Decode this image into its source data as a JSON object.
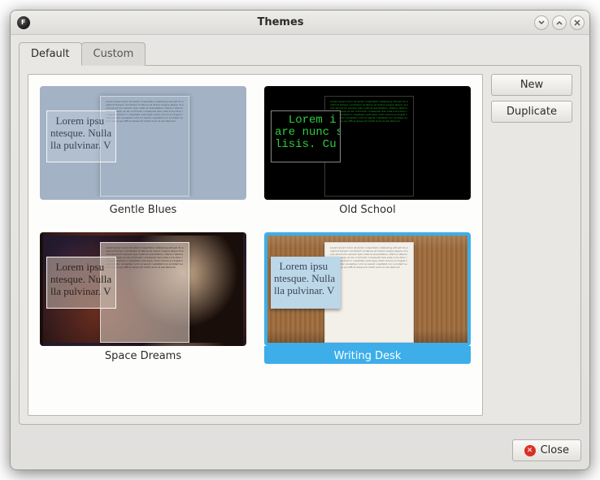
{
  "window": {
    "title": "Themes"
  },
  "tabs": [
    {
      "label": "Default",
      "active": true
    },
    {
      "label": "Custom",
      "active": false
    }
  ],
  "buttons": {
    "new": "New",
    "duplicate": "Duplicate",
    "close": "Close"
  },
  "themes": [
    {
      "name": "Gentle Blues",
      "selected": false,
      "thumb_class": "t1"
    },
    {
      "name": "Old School",
      "selected": false,
      "thumb_class": "t2"
    },
    {
      "name": "Space Dreams",
      "selected": false,
      "thumb_class": "t3"
    },
    {
      "name": "Writing Desk",
      "selected": true,
      "thumb_class": "t4"
    }
  ],
  "sample_text": "  Lorem ipsu\nntesque. Nulla\nlla pulvinar. V",
  "sample_text_mono": "  Lorem i\nare nunc s\nlisis. Cu",
  "filler": "Lorem ipsum dolor sit amet consectetur adipiscing elit sed do eiusmod tempor incididunt ut labore et dolore magna aliqua ut enim ad minim veniam quis nostrud exercitation ullamco laboris nisi ut aliquip ex ea commodo consequat duis aute irure dolor in reprehenderit in voluptate velit esse cillum dolore eu fugiat nulla pariatur excepteur sint occaecat cupidatat non proident sunt in culpa qui officia deserunt mollit anim id est laborum"
}
